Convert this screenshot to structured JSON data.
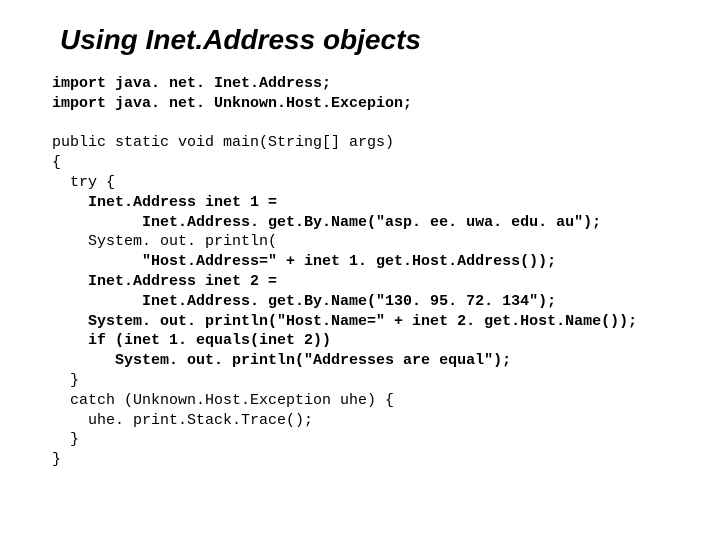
{
  "title": "Using Inet.Address objects",
  "code": {
    "l01": "import java. net. Inet.Address;",
    "l02": "import java. net. Unknown.Host.Excepion;",
    "l03": "",
    "l04": "public static void main(String[] args)",
    "l05": "{",
    "l06": "  try {",
    "l07": "    Inet.Address inet 1 =",
    "l08": "          Inet.Address. get.By.Name(\"asp. ee. uwa. edu. au\");",
    "l09": "    System. out. println(",
    "l10": "          \"Host.Address=\" + inet 1. get.Host.Address());",
    "l11": "    Inet.Address inet 2 =",
    "l12": "          Inet.Address. get.By.Name(\"130. 95. 72. 134\");",
    "l13": "    System. out. println(\"Host.Name=\" + inet 2. get.Host.Name());",
    "l14": "    if (inet 1. equals(inet 2))",
    "l15": "       System. out. println(\"Addresses are equal\");",
    "l16": "  }",
    "l17": "  catch (Unknown.Host.Exception uhe) {",
    "l18": "    uhe. print.Stack.Trace();",
    "l19": "  }",
    "l20": "}"
  }
}
